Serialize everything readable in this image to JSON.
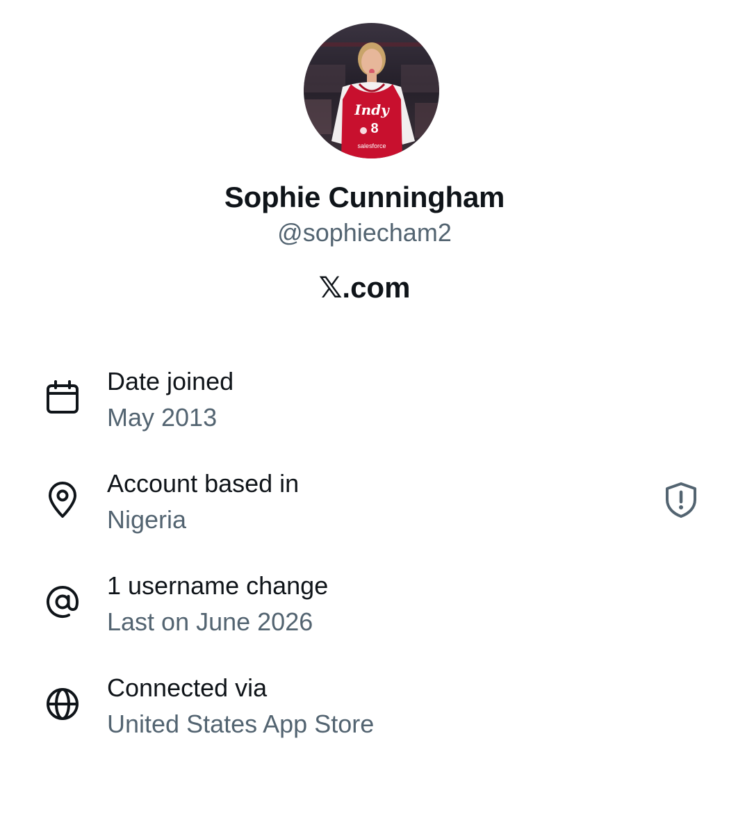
{
  "profile": {
    "display_name": "Sophie Cunningham",
    "handle": "@sophiecham2",
    "source_mark": "𝕏",
    "source_suffix": ".com",
    "avatar_jersey_text": "Indy",
    "avatar_jersey_number": "8",
    "avatar_sponsor": "salesforce"
  },
  "info": {
    "date_joined": {
      "label": "Date joined",
      "value": "May 2013",
      "icon": "calendar-icon"
    },
    "account_based": {
      "label": "Account based in",
      "value": "Nigeria",
      "icon": "location-pin-icon",
      "action_icon": "shield-alert-icon"
    },
    "username_changes": {
      "label": "1 username change",
      "value": "Last on June 2026",
      "icon": "at-sign-icon"
    },
    "connected_via": {
      "label": "Connected via",
      "value": "United States App Store",
      "icon": "globe-icon"
    }
  },
  "colors": {
    "primary_text": "#0f1419",
    "secondary_text": "#536471",
    "background": "#ffffff",
    "jersey_red": "#c8102e"
  }
}
